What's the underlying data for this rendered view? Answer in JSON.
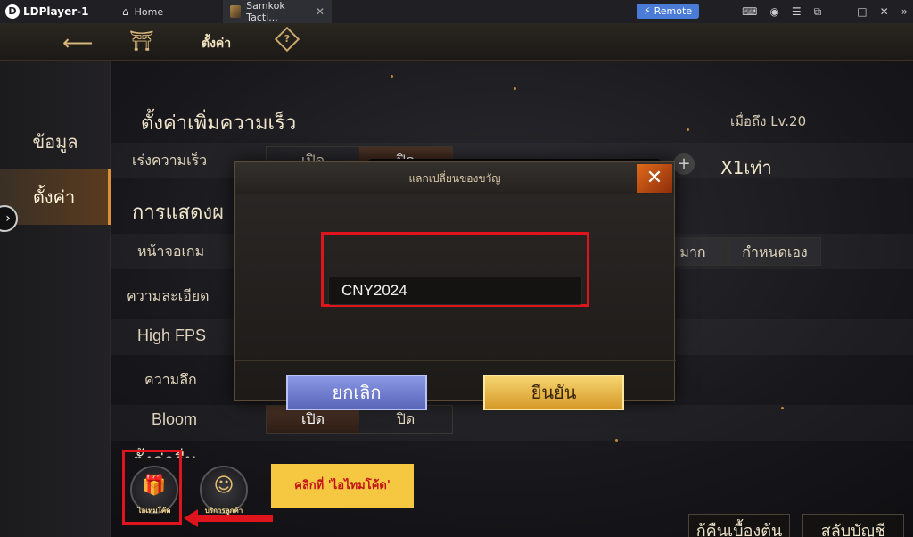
{
  "titlebar": {
    "app_name": "LDPlayer-1",
    "tabs": [
      {
        "label": "Home",
        "icon": "home-icon"
      },
      {
        "label": "Samkok Tacti...",
        "icon": "game-thumbnail"
      }
    ],
    "remote_label": "Remote",
    "accent": "#4a7bd6"
  },
  "game": {
    "top_title": "ตั้งค่า",
    "help_glyph": "?",
    "sidebar": [
      {
        "label": "ข้อมูล",
        "active": false
      },
      {
        "label": "ตั้งค่า",
        "active": true
      }
    ],
    "speed_section": {
      "title": "ตั้งค่าเพิ่มความเร็ว",
      "level_req": "เมื่อถึง Lv.20",
      "row_label": "เร่งความเร็ว",
      "toggle": [
        "เปิด",
        "ปิด"
      ],
      "speed_value": "X1เท่า"
    },
    "display_section": {
      "title": "การแสดงผ",
      "rows": [
        "หน้าจอเกม",
        "ความละเอียด",
        "High FPS",
        "ความลึก",
        "Bloom"
      ],
      "screen_options": [
        "มาก",
        "กำหนดเอง"
      ],
      "bloom_toggle": [
        "เปิด",
        "ปิด"
      ],
      "next_section_partial": "ตั้งค่าอื่น"
    },
    "bottom_buttons": [
      "กู้คืนเบื้องต้น",
      "สลับบัญชี"
    ],
    "icons": [
      {
        "label": "ไอเทมโค้ด",
        "icon": "gift-icon"
      },
      {
        "label": "บริการลูกค้า",
        "icon": "customer-service-icon"
      }
    ],
    "callout_text": "คลิกที่ 'ไอไทมโค้ด'",
    "callout_color": "#f6c842",
    "highlight_color": "#e0141c"
  },
  "modal": {
    "title": "แลกเปลี่ยนของขวัญ",
    "code_value": "CNY2024",
    "cancel_label": "ยกเลิก",
    "confirm_label": "ยืนยัน",
    "close_glyph": "✕"
  }
}
